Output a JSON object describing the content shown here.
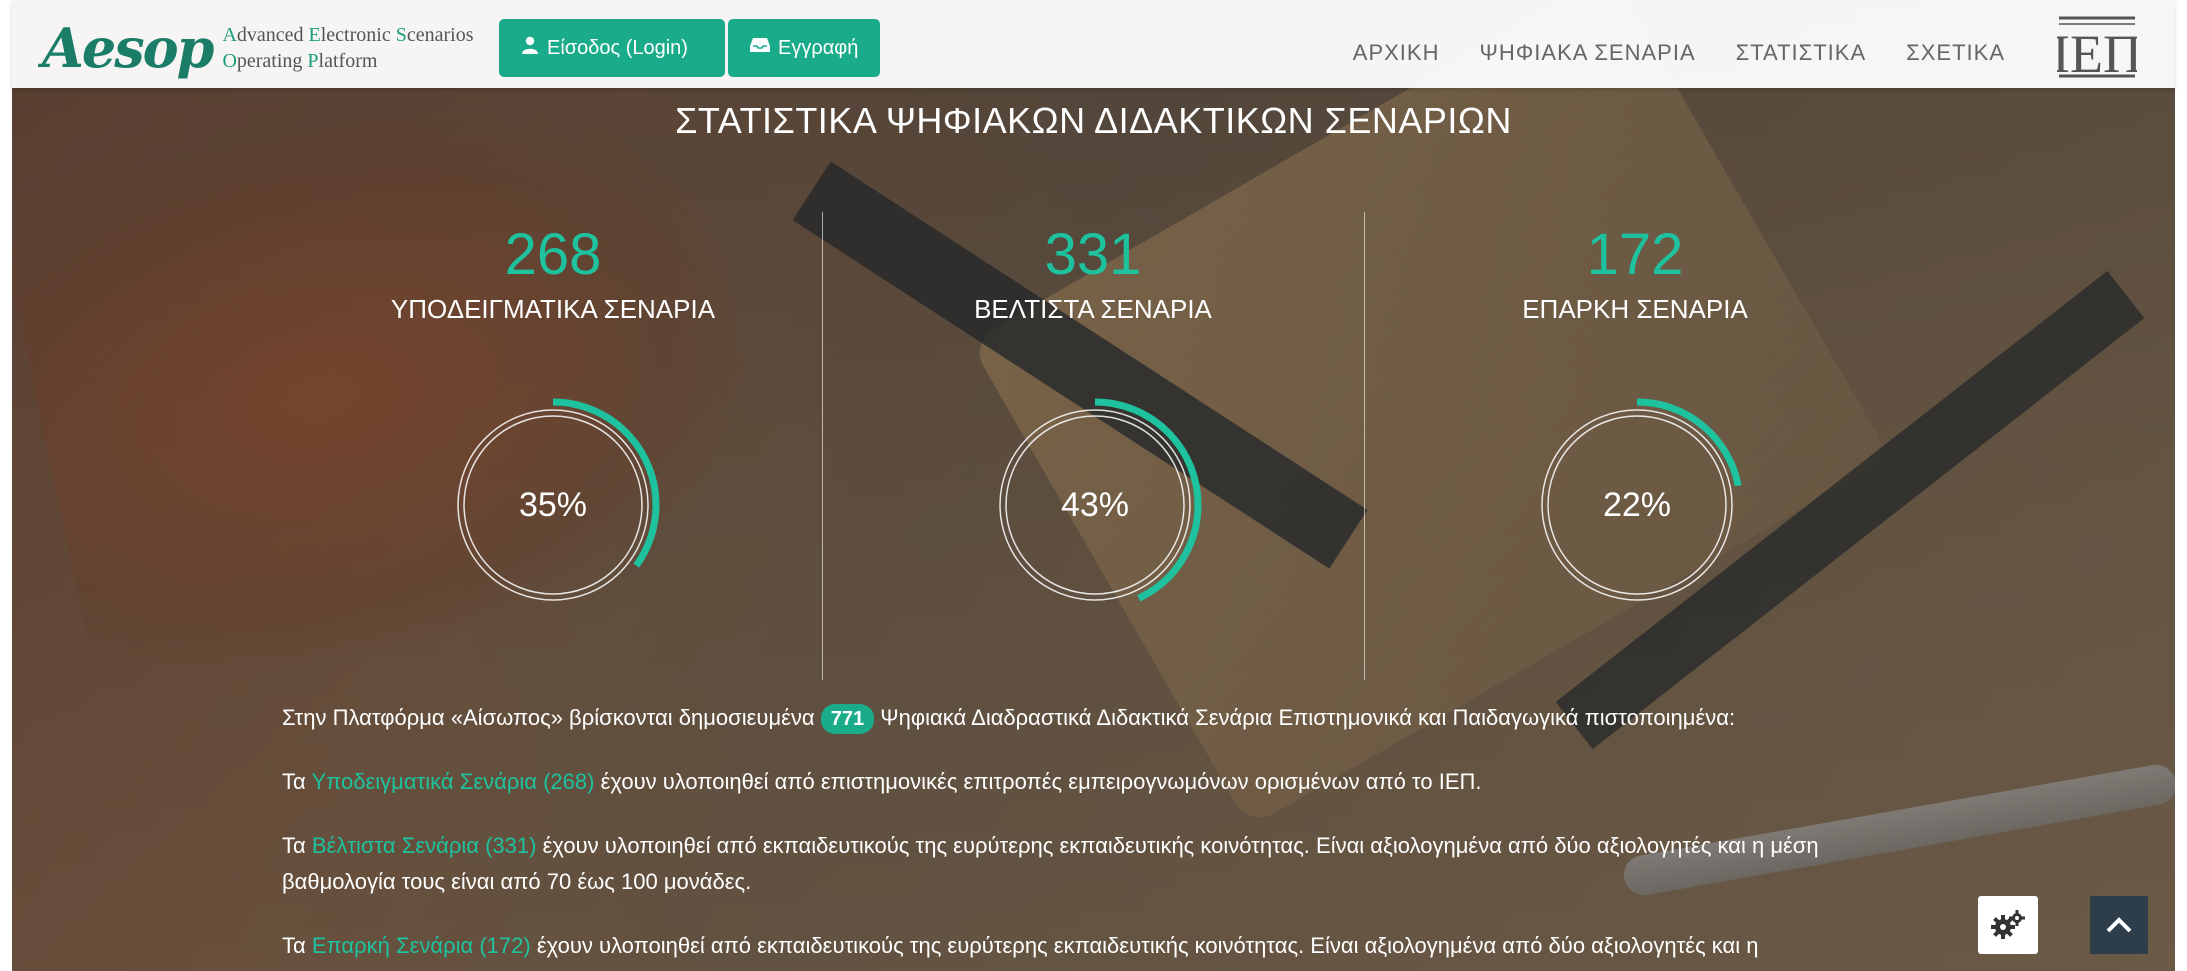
{
  "header": {
    "logo_mark": "Aesop",
    "logo_line1": [
      {
        "cap": "A",
        "rest": "dvanced "
      },
      {
        "cap": "E",
        "rest": "lectronic "
      },
      {
        "cap": "S",
        "rest": "cenarios"
      }
    ],
    "logo_line2": [
      {
        "cap": "O",
        "rest": "perating "
      },
      {
        "cap": "P",
        "rest": "latform"
      }
    ],
    "login_label": "Είσοδος (Login)",
    "register_label": "Εγγραφή",
    "nav": [
      "ΑΡΧΙΚΗ",
      "ΨΗΦΙΑΚΑ ΣΕΝΑΡΙΑ",
      "ΣΤΑΤΙΣΤΙΚΑ",
      "ΣΧΕΤΙΚΑ"
    ],
    "iep_logo_text": "ΙΕΠ"
  },
  "title": "ΣΤΑΤΙΣΤΙΚΑ ΨΗΦΙΑΚΩΝ ΔΙΔΑΚΤΙΚΩΝ ΣΕΝΑΡΙΩΝ",
  "stats": [
    {
      "number": "268",
      "label": "ΥΠΟΔΕΙΓΜΑΤΙΚΑ ΣΕΝΑΡΙΑ",
      "percent_text": "35%",
      "percent": 0.35
    },
    {
      "number": "331",
      "label": "ΒΕΛΤΙΣΤΑ ΣΕΝΑΡΙΑ",
      "percent_text": "43%",
      "percent": 0.43
    },
    {
      "number": "172",
      "label": "ΕΠΑΡΚΗ ΣΕΝΑΡΙΑ",
      "percent_text": "22%",
      "percent": 0.22
    }
  ],
  "intro": {
    "before": "Στην Πλατφόρμα «Αίσωπος» βρίσκονται δημοσιευμένα",
    "count": "771",
    "after": "Ψηφιακά Διαδραστικά Διδακτικά Σενάρια Επιστημονικά και Παιδαγωγικά πιστοποιημένα:"
  },
  "paragraphs": [
    {
      "prefix": "Τα",
      "link": "Υποδειγματικά Σενάρια (268)",
      "text": "έχουν υλοποιηθεί από επιστημονικές επιτροπές εμπειρογνωμόνων ορισμένων από το ΙΕΠ."
    },
    {
      "prefix": "Τα",
      "link": "Βέλτιστα Σενάρια (331)",
      "text": "έχουν υλοποιηθεί από εκπαιδευτικούς της ευρύτερης εκπαιδευτικής κοινότητας. Είναι αξιολογημένα από δύο αξιολογητές και η μέση βαθμολογία τους είναι από 70 έως 100 μονάδες."
    },
    {
      "prefix": "Τα",
      "link": "Επαρκή Σενάρια (172)",
      "text": "έχουν υλοποιηθεί από εκπαιδευτικούς της ευρύτερης εκπαιδευτικής κοινότητας. Είναι αξιολογημένα από δύο αξιολογητές και η"
    }
  ],
  "colors": {
    "accent": "#1aab8a",
    "ring": "#1ec29e"
  },
  "icons": {
    "login": "user-icon",
    "register": "inbox-icon",
    "settings": "gears-icon",
    "back_to_top": "chevron-up-icon"
  }
}
